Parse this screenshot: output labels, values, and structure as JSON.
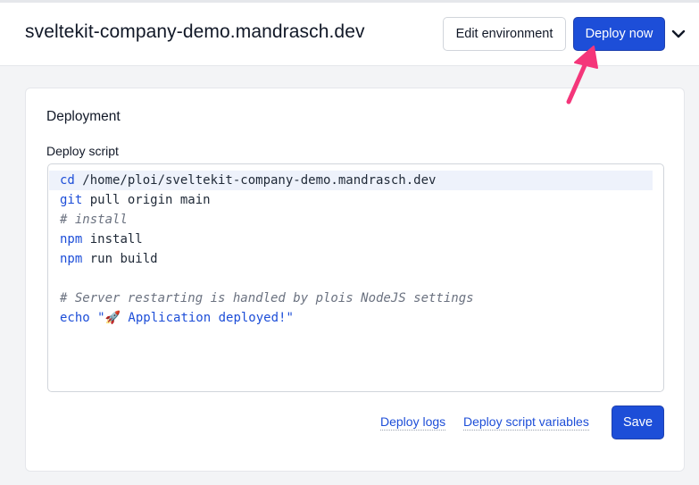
{
  "header": {
    "site_title": "sveltekit-company-demo.mandrasch.dev",
    "edit_environment_label": "Edit environment",
    "deploy_now_label": "Deploy now",
    "dropdown_icon": "chevron-down-icon"
  },
  "deployment": {
    "card_title": "Deployment",
    "script_label": "Deploy script",
    "script_lines": [
      {
        "command": "cd",
        "rest": " /home/ploi/sveltekit-company-demo.mandrasch.dev"
      },
      {
        "command": "git",
        "rest": " pull origin main"
      },
      {
        "comment": "# install"
      },
      {
        "command": "npm",
        "rest": " install"
      },
      {
        "command": "npm",
        "rest": " run build"
      },
      {
        "blank": ""
      },
      {
        "comment": "# Server restarting is handled by plois NodeJS settings"
      },
      {
        "command": "echo",
        "string": " \"🚀 Application deployed!\""
      }
    ],
    "deploy_logs_label": "Deploy logs",
    "script_variables_label": "Deploy script variables",
    "save_label": "Save"
  },
  "colors": {
    "accent": "#1d4ed8",
    "annotation_arrow": "#f4367a"
  }
}
